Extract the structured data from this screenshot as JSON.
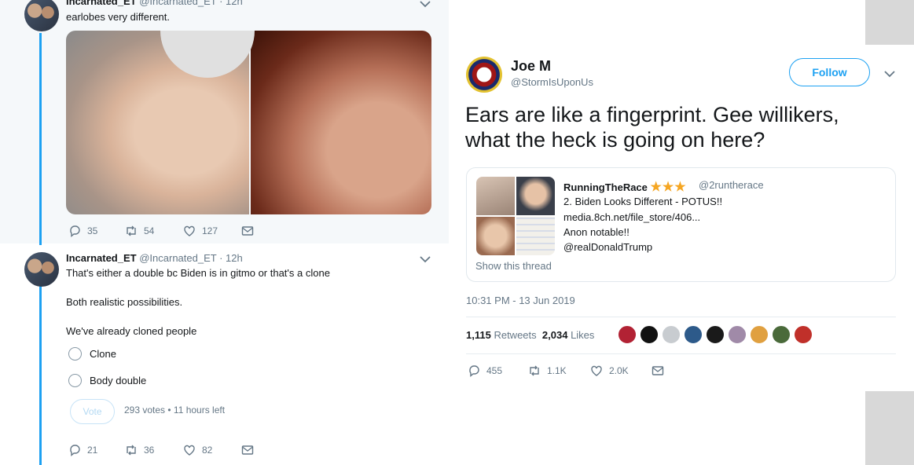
{
  "thread": {
    "tweet1": {
      "name": "Incarnated_ET",
      "handle": "@Incarnated_ET · 12h",
      "text": "earlobes very different.",
      "replies": "35",
      "retweets": "54",
      "likes": "127"
    },
    "tweet2": {
      "name": "Incarnated_ET",
      "handle": "@Incarnated_ET · 12h",
      "line1": "That's either a double bc Biden is in gitmo or that's a clone",
      "line2": "Both realistic possibilities.",
      "line3": "We've already cloned people",
      "poll": {
        "options": [
          "Clone",
          "Body double"
        ],
        "vote_label": "Vote",
        "meta": "293 votes • 11 hours left"
      },
      "replies": "21",
      "retweets": "36",
      "likes": "82"
    }
  },
  "focus_tweet": {
    "name": "Joe M",
    "handle": "@StormIsUponUs",
    "follow_label": "Follow",
    "text": "Ears are like a fingerprint. Gee willikers, what the heck is going on here?",
    "quote": {
      "name": "RunningTheRace",
      "stars": "★★★",
      "handle": "@2runtherace",
      "lines": [
        "2. Biden Looks Different - POTUS!!",
        "media.8ch.net/file_store/406...",
        "Anon notable!!",
        "@realDonaldTrump"
      ],
      "show_thread": "Show this thread"
    },
    "timestamp": "10:31 PM - 13 Jun 2019",
    "retweets_count": "1,115",
    "retweets_label": "Retweets",
    "likes_count": "2,034",
    "likes_label": "Likes",
    "replies": "455",
    "retweets_short": "1.1K",
    "likes_short": "2.0K",
    "liker_colors": [
      "#b22234",
      "#111111",
      "#c8ccd0",
      "#2d5a8a",
      "#1a1a1a",
      "#a08aa8",
      "#e0a040",
      "#4a6a3a",
      "#c0302a"
    ]
  },
  "colors": {
    "accent": "#1da1f2",
    "thread_bg": "#f5f8fa",
    "muted": "#657786"
  }
}
